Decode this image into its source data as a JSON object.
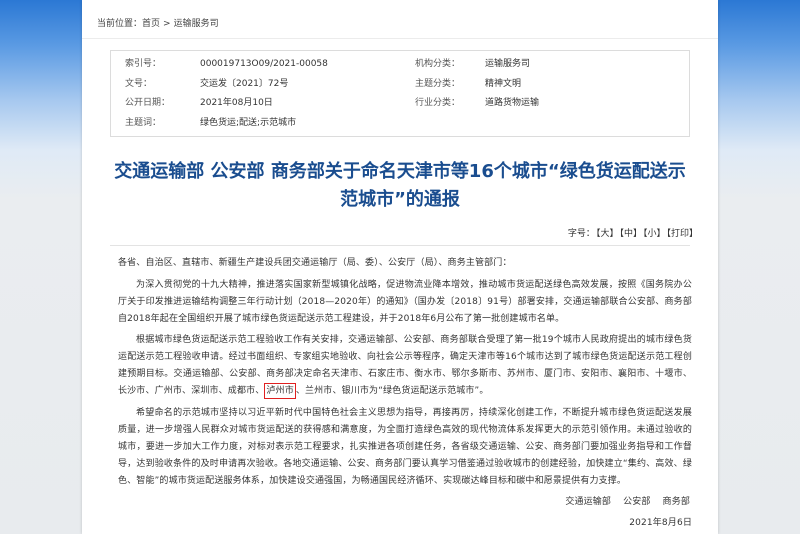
{
  "breadcrumb": {
    "label": "当前位置：",
    "items": [
      "首页",
      "运输服务司"
    ],
    "separator": ">"
  },
  "meta": {
    "rows": [
      [
        {
          "label": "索引号：",
          "value": "000019713O09/2021-00058"
        },
        {
          "label": "机构分类：",
          "value": "运输服务司"
        }
      ],
      [
        {
          "label": "文号：",
          "value": "交运发〔2021〕72号"
        },
        {
          "label": "主题分类：",
          "value": "精神文明"
        }
      ],
      [
        {
          "label": "公开日期：",
          "value": "2021年08月10日"
        },
        {
          "label": "行业分类：",
          "value": "道路货物运输"
        }
      ],
      [
        {
          "label": "主题词：",
          "value": "绿色货运;配送;示范城市"
        }
      ]
    ]
  },
  "title": "交通运输部 公安部 商务部关于命名天津市等16个城市“绿色货运配送示范城市”的通报",
  "toolbar": {
    "label": "字号：",
    "large": "【大】",
    "medium": "【中】",
    "small": "【小】",
    "print": "【打印】"
  },
  "body": {
    "salutation": "各省、自治区、直辖市、新疆生产建设兵团交通运输厅（局、委）、公安厅（局）、商务主管部门：",
    "paragraphs": [
      {
        "text": "为深入贯彻党的十九大精神，推进落实国家新型城镇化战略，促进物流业降本增效，推动城市货运配送绿色高效发展，按照《国务院办公厅关于印发推进运输结构调整三年行动计划（2018—2020年）的通知》（国办发〔2018〕91号）部署安排，交通运输部联合公安部、商务部自2018年起在全国组织开展了城市绿色货运配送示范工程建设，并于2018年6月公布了第一批创建城市名单。"
      },
      {
        "before": "根据城市绿色货运配送示范工程验收工作有关安排，交通运输部、公安部、商务部联合受理了第一批19个城市人民政府提出的城市绿色货运配送示范工程验收申请。经过书面组织、专家组实地验收、向社会公示等程序，确定天津市等16个城市达到了城市绿色货运配送示范工程创建预期目标。交通运输部、公安部、商务部决定命名天津市、石家庄市、衡水市、鄂尔多斯市、苏州市、厦门市、安阳市、襄阳市、十堰市、长沙市、广州市、深圳市、成都市、",
        "highlight": "泸州市",
        "after": "、兰州市、银川市为“绿色货运配送示范城市”。"
      },
      {
        "text": "希望命名的示范城市坚持以习近平新时代中国特色社会主义思想为指导，再接再厉，持续深化创建工作，不断提升城市绿色货运配送发展质量，进一步增强人民群众对城市货运配送的获得感和满意度，为全面打造绿色高效的现代物流体系发挥更大的示范引领作用。未通过验收的城市，要进一步加大工作力度，对标对表示范工程要求，扎实推进各项创建任务，各省级交通运输、公安、商务部门要加强业务指导和工作督导，达到验收条件的及时申请再次验收。各地交通运输、公安、商务部门要认真学习借鉴通过验收城市的创建经验，加快建立“集约、高效、绿色、智能”的城市货运配送服务体系，加快建设交通强国，为畅通国民经济循环、实现碳达峰目标和碳中和愿景提供有力支撑。"
      }
    ],
    "signatories": [
      "交通运输部",
      "公安部",
      "商务部"
    ],
    "date": "2021年8月6日"
  },
  "colors": {
    "title": "#1a4d8f",
    "highlight_box": "#e02020",
    "header_blue": "#2b78d4"
  }
}
